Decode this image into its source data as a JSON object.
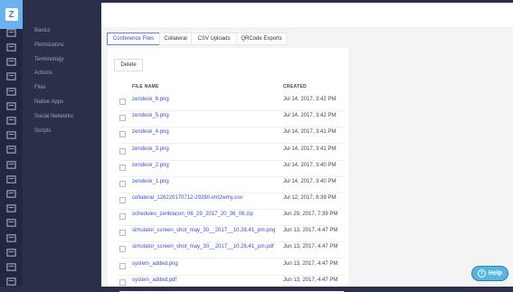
{
  "sidebar": {
    "logo_letter": "Z",
    "icons": [
      "bar-chart-icon",
      "chat-icon",
      "megaphone-icon",
      "users-icon",
      "tag-icon",
      "document-icon",
      "monitor-icon",
      "file-icon",
      "list-icon",
      "doc-stack-icon",
      "brush-icon",
      "trophy-icon",
      "document2-icon",
      "presentation-icon",
      "eye-icon",
      "database-icon",
      "gear-icon",
      "exit-icon"
    ],
    "items": [
      "Basics",
      "Permissions",
      "Terminology",
      "Actions",
      "Files",
      "Native Apps",
      "Social Networks",
      "Scripts"
    ]
  },
  "tabs": [
    {
      "label": "Conference Files",
      "active": true
    },
    {
      "label": "Collateral",
      "active": false
    },
    {
      "label": "CSV Uploads",
      "active": false
    },
    {
      "label": "QRCode Exports",
      "active": false
    }
  ],
  "toolbar": {
    "delete_label": "Delete"
  },
  "table": {
    "columns": {
      "name": "FILE NAME",
      "created": "CREATED"
    },
    "rows": [
      {
        "name": "zendesk_6.png",
        "created": "Jul 14, 2017, 3:42 PM"
      },
      {
        "name": "zendesk_5.png",
        "created": "Jul 14, 2017, 3:42 PM"
      },
      {
        "name": "zendesk_4.png",
        "created": "Jul 14, 2017, 3:41 PM"
      },
      {
        "name": "zendesk_3.png",
        "created": "Jul 14, 2017, 3:41 PM"
      },
      {
        "name": "zendesk_2.png",
        "created": "Jul 14, 2017, 3:40 PM"
      },
      {
        "name": "zendesk_1.png",
        "created": "Jul 14, 2017, 3:40 PM"
      },
      {
        "name": "collateral_126220170712-29280-imt2wmy.csv",
        "created": "Jul 12, 2017, 8:39 PM"
      },
      {
        "name": "schedules_zenblacon_06_29_2017_20_36_06.zip",
        "created": "Jun 29, 2017, 7:39 PM"
      },
      {
        "name": "simulator_screen_shot_may_30__2017__10.28.41_pm.png",
        "created": "Jun 13, 2017, 4:47 PM"
      },
      {
        "name": "simulator_screen_shot_may_30__2017__10.28.41_pm.pdf",
        "created": "Jun 13, 2017, 4:47 PM"
      },
      {
        "name": "system_added.png",
        "created": "Jun 13, 2017, 4:47 PM"
      },
      {
        "name": "system_added.pdf",
        "created": "Jun 13, 2017, 4:47 PM"
      }
    ]
  },
  "help": {
    "label": "Help"
  },
  "colors": {
    "accent": "#6ab2f2",
    "link": "#3a4fd0",
    "help": "#57b6df",
    "sidebar": "#2c2f4a"
  }
}
